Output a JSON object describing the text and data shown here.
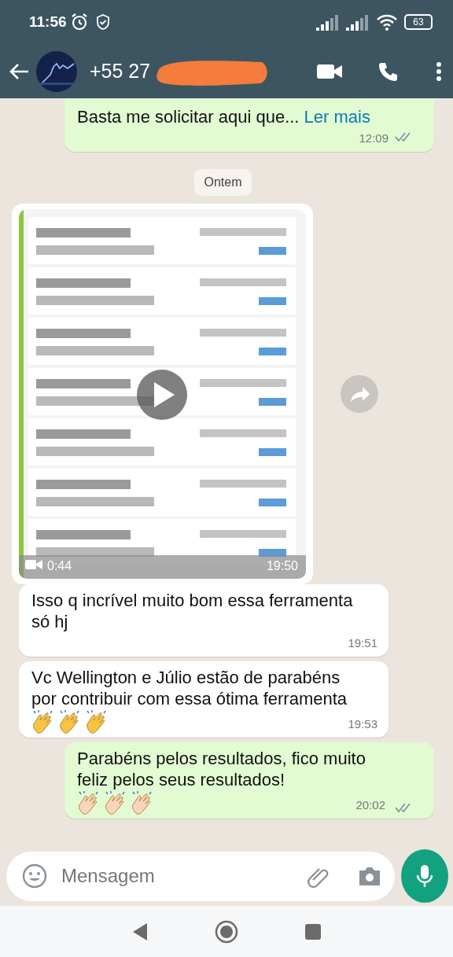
{
  "status_bar": {
    "time": "11:56",
    "battery": "63"
  },
  "header": {
    "contact": "+55 27"
  },
  "messages": [
    {
      "kind": "text",
      "outgoing": true,
      "text": "Basta me solicitar aqui que...",
      "link": "Ler mais",
      "time": "12:09",
      "read": true
    },
    {
      "kind": "date",
      "text": "Ontem"
    },
    {
      "kind": "video",
      "outgoing": false,
      "duration": "0:44",
      "time": "19:50"
    },
    {
      "kind": "text",
      "outgoing": false,
      "text": "Isso q incrível muito bom essa ferramenta só hj",
      "time": "19:51"
    },
    {
      "kind": "text",
      "outgoing": false,
      "text": "Vc Wellington e Júlio estão de parabéns por contribuir com essa ótima ferramenta",
      "time": "19:53",
      "emojis": [
        {
          "kind": "clap",
          "color": "#f6c342"
        },
        {
          "kind": "clap",
          "color": "#f6c342"
        },
        {
          "kind": "clap",
          "color": "#f6c342"
        }
      ]
    },
    {
      "kind": "text",
      "outgoing": true,
      "text": "Parabéns pelos resultados, fico muito feliz pelos seus resultados!",
      "time": "20:02",
      "read": true,
      "emojis": [
        {
          "kind": "clap",
          "color": "#f7d6bc"
        },
        {
          "kind": "clap",
          "color": "#f7d6bc"
        },
        {
          "kind": "clap",
          "color": "#f7d6bc"
        }
      ]
    }
  ],
  "composer": {
    "placeholder": "Mensagem"
  }
}
